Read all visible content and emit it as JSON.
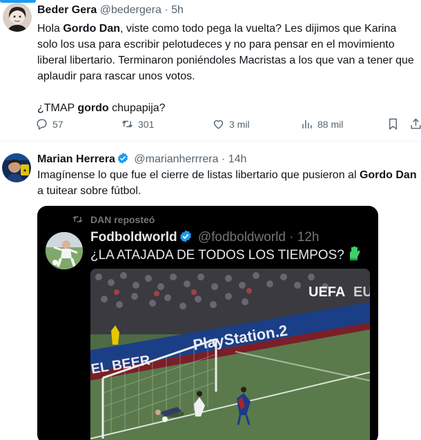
{
  "tweets": [
    {
      "name": "Beder Gera",
      "handle": "@bedergera",
      "separator": "·",
      "time": "5h",
      "body": {
        "p1_a": "Hola ",
        "p1_b": "Gordo Dan",
        "p1_c": ", viste como todo pega la vuelta? Les dijimos que Karina solo los usa para escribir pelotudeces y no para pensar en el movimiento liberal libertario. Terminaron poniéndoles Macristas a los que van a tener que aplaudir para rascar unos votos.",
        "p2_a": "¿TMAP ",
        "p2_b": "gordo",
        "p2_c": " chupapija?"
      },
      "actions": {
        "replies": "57",
        "reposts": "301",
        "likes": "3 mil",
        "views": "88 mil"
      }
    },
    {
      "name": "Marian Herrera",
      "handle": "@marianherrrera",
      "separator": "·",
      "time": "14h",
      "body": {
        "a": "Imagínense lo que fue el cierre de listas libertario que pusieron al ",
        "b": "Gordo Dan",
        "c": " a tuitear sobre fútbol."
      },
      "quoted": {
        "repost_label": "DAN reposteó",
        "name": "Fodboldworld",
        "handle": "@fodboldworld",
        "separator": "·",
        "time": "12h",
        "text": "¿LA ATAJADA DE TODOS LOS TIEMPOS?",
        "media": {
          "ad_board": "PlayStation.2",
          "ad_board_2": "EL BEER",
          "watermark": "UEFA",
          "watermark_2": "EU"
        }
      }
    }
  ],
  "colors": {
    "accent": "#1d9bf0",
    "secondary_text": "#536471",
    "verified": "#1d9bf0",
    "card_bg": "#000000"
  },
  "icons": [
    "reply-icon",
    "repost-icon",
    "like-icon",
    "views-icon",
    "bookmark-icon",
    "share-icon",
    "verified-badge-icon",
    "goalkeeper-glove-icon"
  ]
}
